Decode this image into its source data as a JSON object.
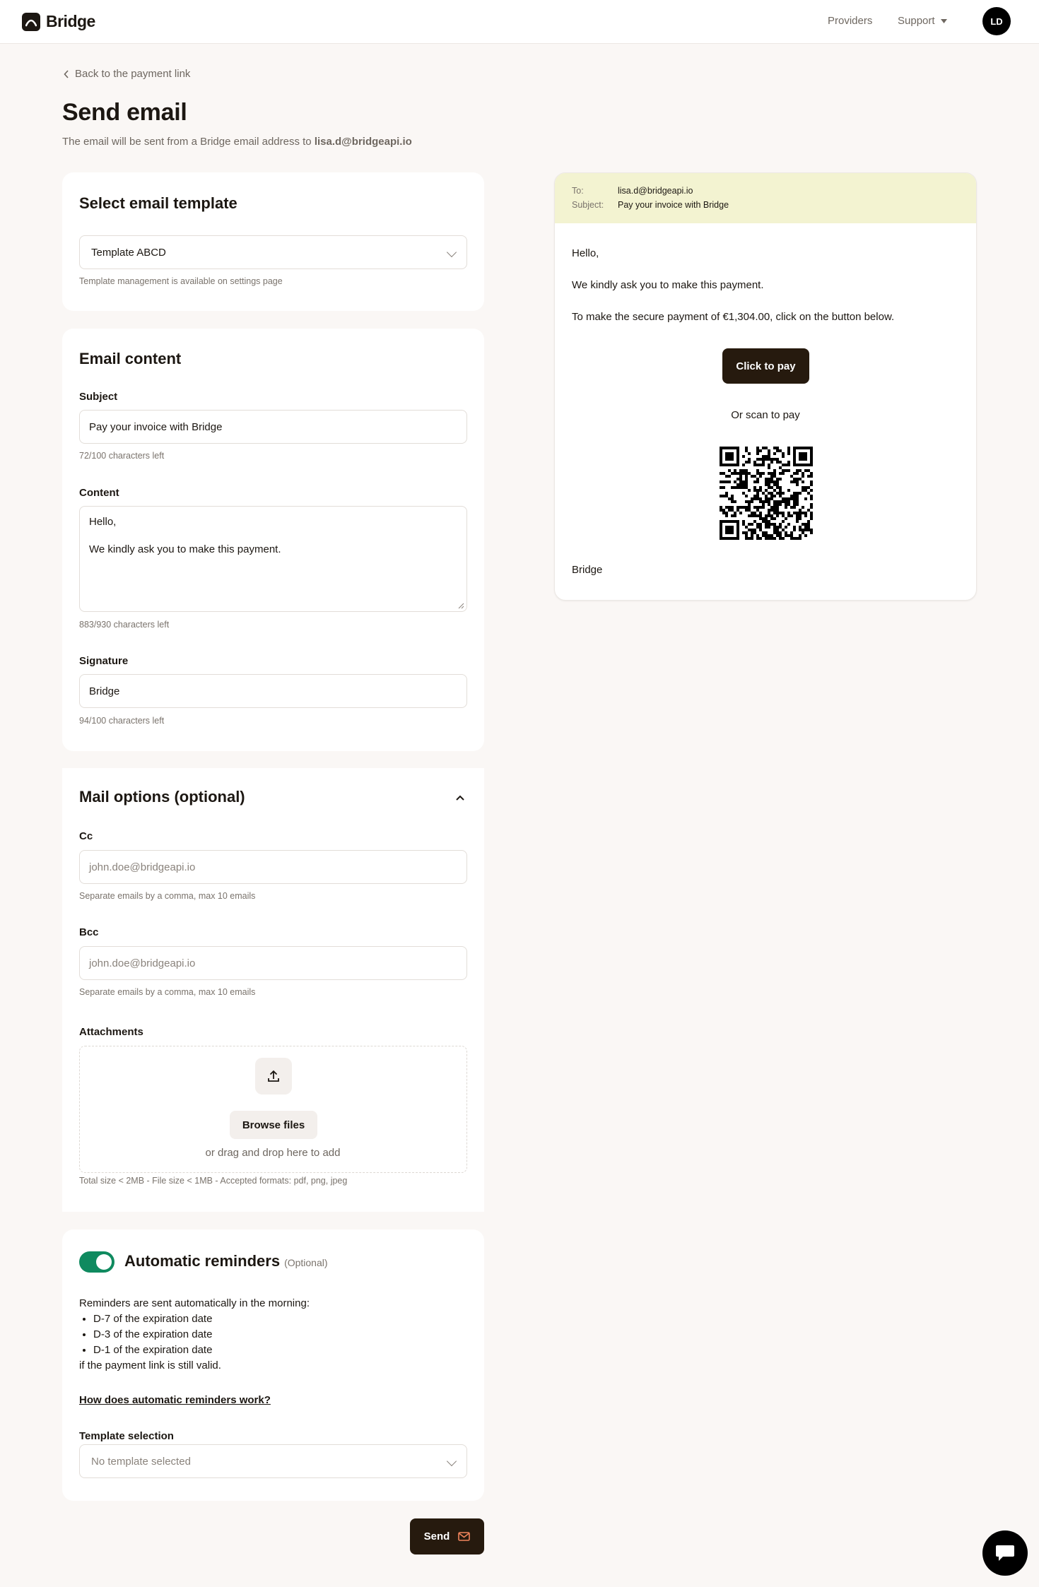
{
  "header": {
    "brand": "Bridge",
    "nav": {
      "providers": "Providers",
      "support": "Support"
    },
    "avatar": "LD"
  },
  "back_link": "Back to the payment link",
  "page": {
    "title": "Send email",
    "subtitle_prefix": "The email will be sent from a Bridge email address to ",
    "recipient": "lisa.d@bridgeapi.io"
  },
  "template_card": {
    "title": "Select email template",
    "selected": "Template ABCD",
    "hint": "Template management is available on settings page"
  },
  "content_card": {
    "title": "Email content",
    "subject_label": "Subject",
    "subject_value": "Pay your invoice with Bridge",
    "subject_hint": "72/100 characters left",
    "content_label": "Content",
    "content_line1": "Hello,",
    "content_line2": "We kindly ask you to make this payment.",
    "content_hint": "883/930 characters left",
    "signature_label": "Signature",
    "signature_value": "Bridge",
    "signature_hint": "94/100 characters left"
  },
  "mail_options": {
    "title": "Mail options (optional)",
    "cc_label": "Cc",
    "cc_placeholder": "john.doe@bridgeapi.io",
    "cc_hint": "Separate emails by a comma, max 10 emails",
    "bcc_label": "Bcc",
    "bcc_placeholder": "john.doe@bridgeapi.io",
    "bcc_hint": "Separate emails by a comma, max 10 emails",
    "attachments_label": "Attachments",
    "browse_label": "Browse files",
    "drag_text": "or drag and drop here to add",
    "attachments_hint": "Total size < 2MB - File size < 1MB - Accepted formats: pdf, png, jpeg"
  },
  "reminders": {
    "title": "Automatic reminders",
    "optional": "(Optional)",
    "enabled": true,
    "intro": "Reminders are sent automatically in the morning:",
    "items": [
      "D-7 of the expiration date",
      "D-3 of the expiration date",
      "D-1 of the expiration date"
    ],
    "outro": "if the payment link is still valid.",
    "help_link": "How does automatic reminders work?",
    "template_label": "Template selection",
    "template_placeholder": "No template selected"
  },
  "send_button": "Send",
  "preview": {
    "to_label": "To:",
    "to_value": "lisa.d@bridgeapi.io",
    "subject_label": "Subject:",
    "subject_value": "Pay your invoice with Bridge",
    "greeting": "Hello,",
    "line1": "We kindly ask you to make this payment.",
    "line2": "To make the secure payment of €1,304.00, click on the button below.",
    "pay_button": "Click to pay",
    "scan_text": "Or scan to pay",
    "signature": "Bridge"
  },
  "colors": {
    "background": "#faf7f5",
    "primary_button": "#261a0e",
    "toggle_on": "#0f8a5f",
    "preview_header": "#f3f3d1"
  }
}
